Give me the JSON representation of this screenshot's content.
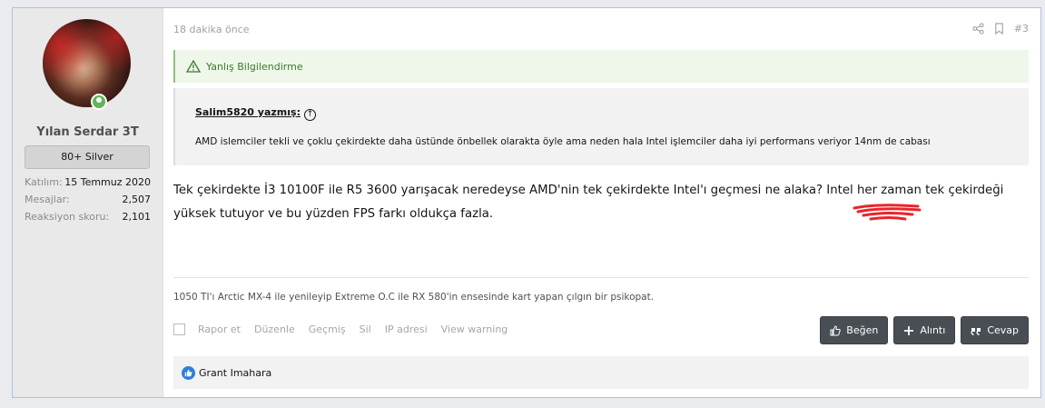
{
  "user": {
    "name": "Yılan Serdar 3T",
    "badge": "80+ Silver",
    "stats": [
      {
        "label": "Katılım:",
        "value": "15 Temmuz 2020"
      },
      {
        "label": "Mesajlar:",
        "value": "2,507"
      },
      {
        "label": "Reaksiyon skoru:",
        "value": "2,101"
      }
    ],
    "online": true
  },
  "post": {
    "time": "18 dakika önce",
    "number": "#3",
    "warning": "Yanlış Bilgilendirme",
    "quote": {
      "author": "Salim5820 yazmış:",
      "text": "AMD islemciler tekli ve çoklu çekirdekte daha üstünde önbellek olarakta öyle ama neden hala Intel işlemciler daha iyi performans veriyor 14nm de cabası"
    },
    "body": "Tek çekirdekte İ3 10100F ile R5 3600 yarışacak neredeyse AMD'nin tek çekirdekte Intel'ı geçmesi ne alaka? Intel her zaman tek çekirdeği yüksek tutuyor ve bu yüzden FPS farkı oldukça fazla.",
    "signature": "1050 TI'ı Arctic MX-4 ile yenileyip Extreme O.C ile RX 580'in ensesinde kart yapan çılgın bir psikopat.",
    "actions": [
      "Rapor et",
      "Düzenle",
      "Geçmiş",
      "Sil",
      "IP adresi",
      "View warning"
    ],
    "buttons": {
      "like": "Beğen",
      "quote": "Alıntı",
      "reply": "Cevap"
    },
    "reactions": "Grant Imahara"
  },
  "icons": [
    "share-icon",
    "bookmark-icon",
    "warning-icon",
    "arrow-up-circle-icon",
    "thumbs-up-icon",
    "plus-icon",
    "quote-icon",
    "like-reaction-icon"
  ],
  "colors": {
    "accent_button": "#484e54",
    "warning_bg": "#eef7ea",
    "warning_text": "#3d7a2e",
    "online": "#63b35b",
    "like": "#2f7ed8"
  }
}
